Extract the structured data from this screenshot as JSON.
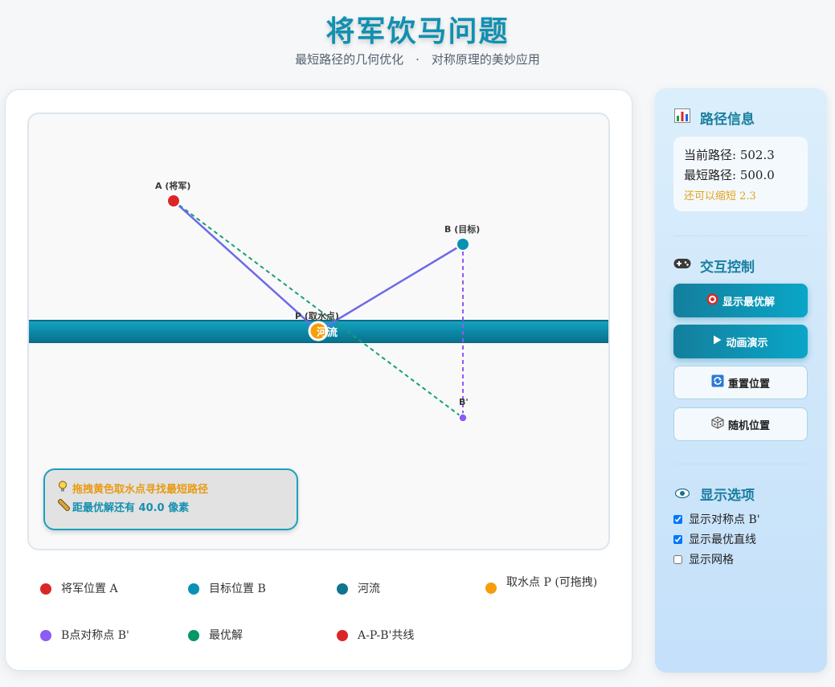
{
  "header": {
    "title": "将军饮马问题",
    "subtitle": "最短路径的几何优化　·　对称原理的美妙应用"
  },
  "canvas": {
    "labels": {
      "a": "A (将军)",
      "b": "B (目标)",
      "p": "P (取水点)",
      "b_prime": "B'",
      "river": "河流"
    },
    "hint": {
      "drag_icon": "lightbulb-icon",
      "drag_text": "拖拽黄色取水点寻找最短路径",
      "distance_icon": "ruler-icon",
      "distance_text": "距最优解还有 40.0 像素"
    }
  },
  "legend": [
    {
      "label": "将军位置 A",
      "color": "#dc2626"
    },
    {
      "label": "目标位置 B",
      "color": "#0891b2"
    },
    {
      "label": "河流",
      "color": "#0e7490"
    },
    {
      "label": "取水点 P (可拖拽)",
      "color": "#f59e0b"
    },
    {
      "label": "B点对称点 B'",
      "color": "#8b5cf6"
    },
    {
      "label": "最优解",
      "color": "#059669"
    },
    {
      "label": "A-P-B'共线",
      "color": "#dc2626"
    }
  ],
  "path_info": {
    "title": "路径信息",
    "icon": "bar-chart-icon",
    "current": "当前路径: 502.3",
    "shortest": "最短路径: 500.0",
    "remaining": "还可以缩短 2.3"
  },
  "controls": {
    "title": "交互控制",
    "icon": "gamepad-icon",
    "show_optimal": "显示最优解",
    "show_optimal_icon": "target-icon",
    "animate": "动画演示",
    "animate_icon": "play-icon",
    "reset": "重置位置",
    "reset_icon": "refresh-icon",
    "random": "随机位置",
    "random_icon": "dice-icon"
  },
  "display_options": {
    "title": "显示选项",
    "icon": "eye-icon",
    "items": [
      {
        "label": "显示对称点 B'",
        "checked": true
      },
      {
        "label": "显示最优直线",
        "checked": true
      },
      {
        "label": "显示网格",
        "checked": false
      }
    ]
  }
}
